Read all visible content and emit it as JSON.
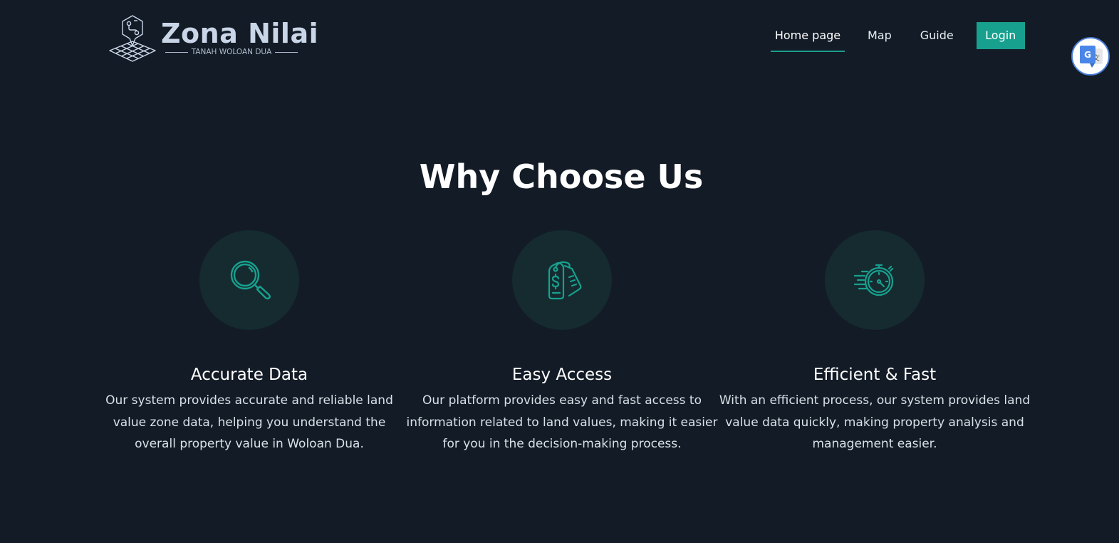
{
  "header": {
    "logo_title": "Zona Nilai",
    "logo_subtitle": "TANAH WOLOAN DUA",
    "nav": {
      "home": "Home page",
      "map": "Map",
      "guide": "Guide",
      "login": "Login"
    }
  },
  "section": {
    "title": "Why Choose Us",
    "features": [
      {
        "icon": "search-icon",
        "title": "Accurate Data",
        "text": "Our system provides accurate and reliable land value zone data, helping you understand the overall property value in Woloan Dua."
      },
      {
        "icon": "price-tag-icon",
        "title": "Easy Access",
        "text": "Our platform provides easy and fast access to information related to land values, making it easier for you in the decision-making process."
      },
      {
        "icon": "stopwatch-icon",
        "title": "Efficient & Fast",
        "text": "With an efficient process, our system provides land value data quickly, making property analysis and management easier."
      }
    ]
  },
  "colors": {
    "background": "#131b26",
    "accent": "#17a08e",
    "icon_circle": "#152b30"
  }
}
